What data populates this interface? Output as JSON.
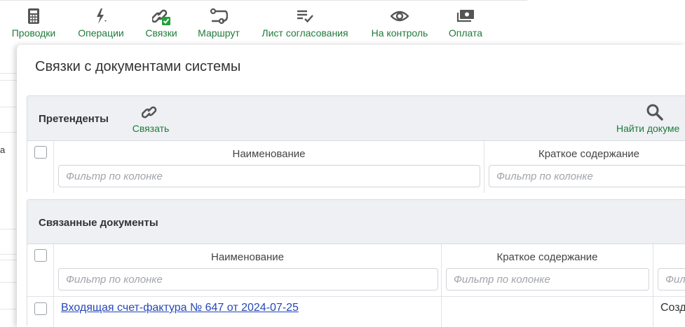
{
  "toolbar": {
    "items": [
      {
        "label": "Проводки",
        "icon": "calculator-icon"
      },
      {
        "label": "Операции",
        "icon": "lightning-icon"
      },
      {
        "label": "Связки",
        "icon": "link-check-icon"
      },
      {
        "label": "Маршрут",
        "icon": "route-icon"
      },
      {
        "label": "Лист согласования",
        "icon": "checklist-icon"
      },
      {
        "label": "На контроль",
        "icon": "eye-icon"
      },
      {
        "label": "Оплата",
        "icon": "money-icon"
      }
    ]
  },
  "background": {
    "visible_char": "а"
  },
  "dialog": {
    "title": "Связки с документами системы",
    "candidates": {
      "title": "Претенденты",
      "link_button": "Связать",
      "find_button": "Найти докуме",
      "columns": [
        "Наименование",
        "Краткое содержание"
      ],
      "filter_placeholder": "Фильтр по колонке"
    },
    "linked": {
      "title": "Связанные документы",
      "columns": [
        "Наименование",
        "Краткое содержание",
        ""
      ],
      "filter_placeholder": "Фильтр по колонке",
      "rows": [
        {
          "name": "Входящая счет-фактура № 647 от 2024-07-25",
          "summary": "",
          "third": "Созд"
        }
      ]
    }
  },
  "colors": {
    "accent_green": "#1f7a3a",
    "link_blue": "#2547b8",
    "badge_green": "#21a038",
    "panel_bg": "#eef0f3"
  }
}
